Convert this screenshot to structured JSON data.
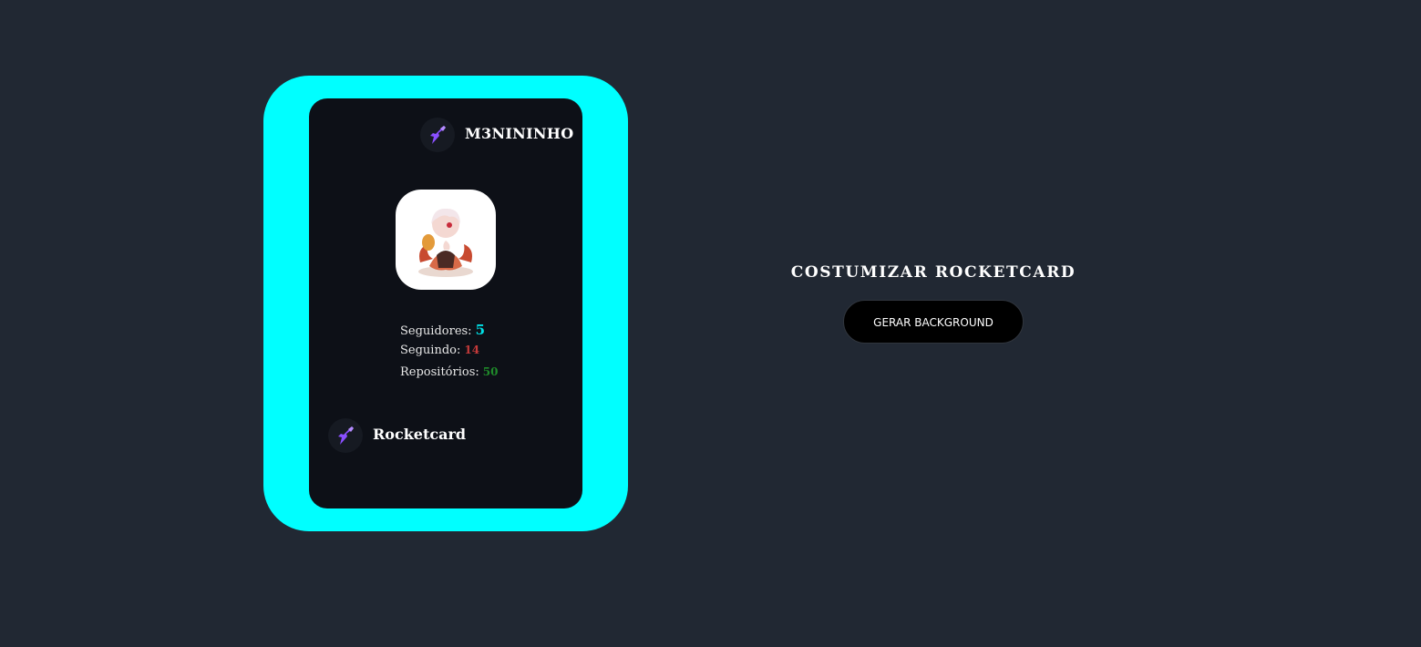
{
  "card": {
    "username": "M3NININHO",
    "avatar_alt": "avatar",
    "stats": {
      "followers_label": "Seguidores:",
      "followers_value": "5",
      "following_label": "Seguindo:",
      "following_value": "14",
      "repos_label": "Repositórios:",
      "repos_value": "50"
    },
    "brand": "Rocketcard",
    "frame_color": "#00ffff",
    "logo_icon": "rocket-icon"
  },
  "panel": {
    "title": "COSTUMIZAR ROCKETCARD",
    "generate_button_label": "GERAR BACKGROUND"
  },
  "colors": {
    "page_background": "#212833",
    "card_background": "#0d1017",
    "followers": "#00e0e6",
    "following": "#c43a3a",
    "repos": "#1f8a2a"
  }
}
